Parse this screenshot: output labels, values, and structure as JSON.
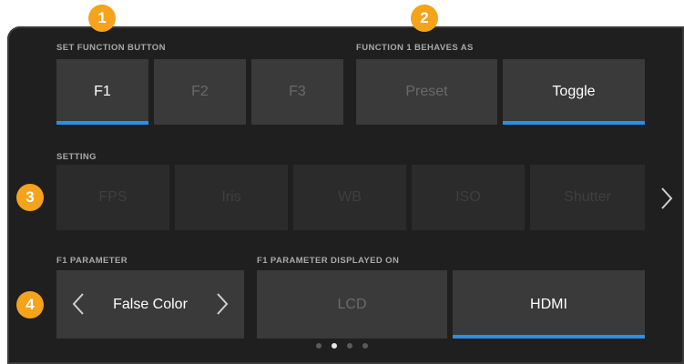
{
  "markers": [
    "1",
    "2",
    "3",
    "4"
  ],
  "set_function": {
    "label": "SET FUNCTION BUTTON",
    "buttons": [
      "F1",
      "F2",
      "F3"
    ],
    "selected": "F1"
  },
  "behaves_as": {
    "label": "FUNCTION 1 BEHAVES AS",
    "options": [
      "Preset",
      "Toggle"
    ],
    "selected": "Toggle"
  },
  "setting": {
    "label": "SETTING",
    "options": [
      "FPS",
      "Iris",
      "WB",
      "ISO",
      "Shutter"
    ],
    "next_icon": "chevron-right-icon"
  },
  "parameter": {
    "label": "F1 PARAMETER",
    "value": "False Color",
    "prev_icon": "chevron-left-icon",
    "next_icon": "chevron-right-icon"
  },
  "displayed_on": {
    "label": "F1 PARAMETER DISPLAYED ON",
    "options": [
      "LCD",
      "HDMI"
    ],
    "selected": "HDMI"
  },
  "pagination": {
    "pages": 4,
    "current": 2
  },
  "colors": {
    "accent": "#2a8fe8",
    "marker": "#f5a31a",
    "panel": "#1f1f1f",
    "button": "#3a3a3a"
  }
}
